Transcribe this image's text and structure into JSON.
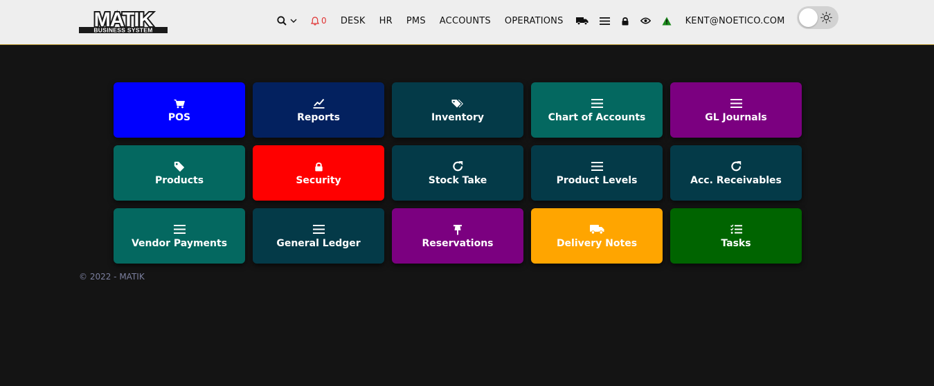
{
  "brand": {
    "name": "MATIK",
    "tagline": "BUSINESS SYSTEM"
  },
  "navbar": {
    "search_icon": "search-icon",
    "notifications": {
      "icon": "bell-icon",
      "count": "0"
    },
    "menu": [
      "DESK",
      "HR",
      "PMS",
      "ACCOUNTS",
      "OPERATIONS"
    ],
    "icons": [
      "truck-icon",
      "list-icon",
      "lock-icon",
      "eye-icon",
      "warning-icon"
    ],
    "user": "KENT@NOETICO.COM",
    "theme_toggle": "sun-icon"
  },
  "tiles": [
    {
      "label": "POS",
      "icon": "cart-icon",
      "color": "#0000ff"
    },
    {
      "label": "Reports",
      "icon": "chart-line-icon",
      "color": "#03215f"
    },
    {
      "label": "Inventory",
      "icon": "tags-icon",
      "color": "#043a48"
    },
    {
      "label": "Chart of Accounts",
      "icon": "list-icon",
      "color": "#046860"
    },
    {
      "label": "GL Journals",
      "icon": "list-icon",
      "color": "#7b0080"
    },
    {
      "label": "Products",
      "icon": "tag-icon",
      "color": "#046860"
    },
    {
      "label": "Security",
      "icon": "lock-icon",
      "color": "#ff0000"
    },
    {
      "label": "Stock Take",
      "icon": "refresh-icon",
      "color": "#043a48"
    },
    {
      "label": "Product Levels",
      "icon": "list-icon",
      "color": "#043a48"
    },
    {
      "label": "Acc. Receivables",
      "icon": "refresh-icon",
      "color": "#043a48"
    },
    {
      "label": "Vendor Payments",
      "icon": "list-icon",
      "color": "#046860"
    },
    {
      "label": "General Ledger",
      "icon": "list-icon",
      "color": "#043a48"
    },
    {
      "label": "Reservations",
      "icon": "pin-icon",
      "color": "#7b0080"
    },
    {
      "label": "Delivery Notes",
      "icon": "truck-icon",
      "color": "#ffa500"
    },
    {
      "label": "Tasks",
      "icon": "checklist-icon",
      "color": "#006400"
    }
  ],
  "footer": {
    "text": "© 2022 - MATIK"
  }
}
